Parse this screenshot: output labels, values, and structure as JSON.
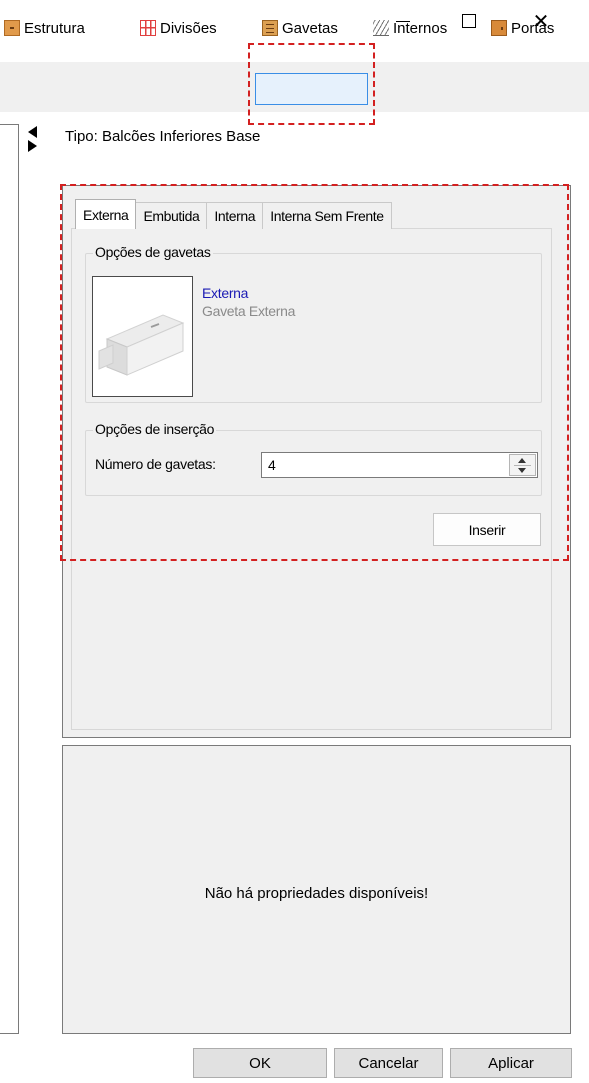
{
  "window": {
    "minimize_icon": "minimize-icon",
    "maximize_icon": "maximize-icon",
    "close_icon": "close-icon",
    "close_glyph": "✕"
  },
  "toolbar": {
    "items": [
      {
        "label": "Estrutura",
        "icon": "estrutura-icon"
      },
      {
        "label": "Divisões",
        "icon": "divisoes-grid-icon"
      },
      {
        "label": "Gavetas",
        "icon": "gavetas-drawer-icon"
      },
      {
        "label": "Internos",
        "icon": "internos-shelves-icon"
      },
      {
        "label": "Portas",
        "icon": "portas-door-icon"
      }
    ],
    "selected": "Gavetas"
  },
  "tipo": "Tipo: Balcões Inferiores Base",
  "tabs": [
    "Externa",
    "Embutida",
    "Interna",
    "Interna Sem Frente"
  ],
  "active_tab": "Externa",
  "drawer_options": {
    "title": "Opções de gavetas",
    "item_name": "Externa",
    "item_description": "Gaveta Externa"
  },
  "insert_options": {
    "title": "Opções de inserção",
    "count_label": "Número de gavetas:",
    "count_value": "4",
    "insert_button": "Inserir"
  },
  "properties": {
    "empty_message": "Não há propriedades disponíveis!"
  },
  "footer": {
    "ok": "OK",
    "cancel": "Cancelar",
    "apply": "Aplicar"
  },
  "colors": {
    "highlight": "#d32020",
    "link": "#1a1ab4",
    "selected_tool": "#3a8ee6"
  }
}
